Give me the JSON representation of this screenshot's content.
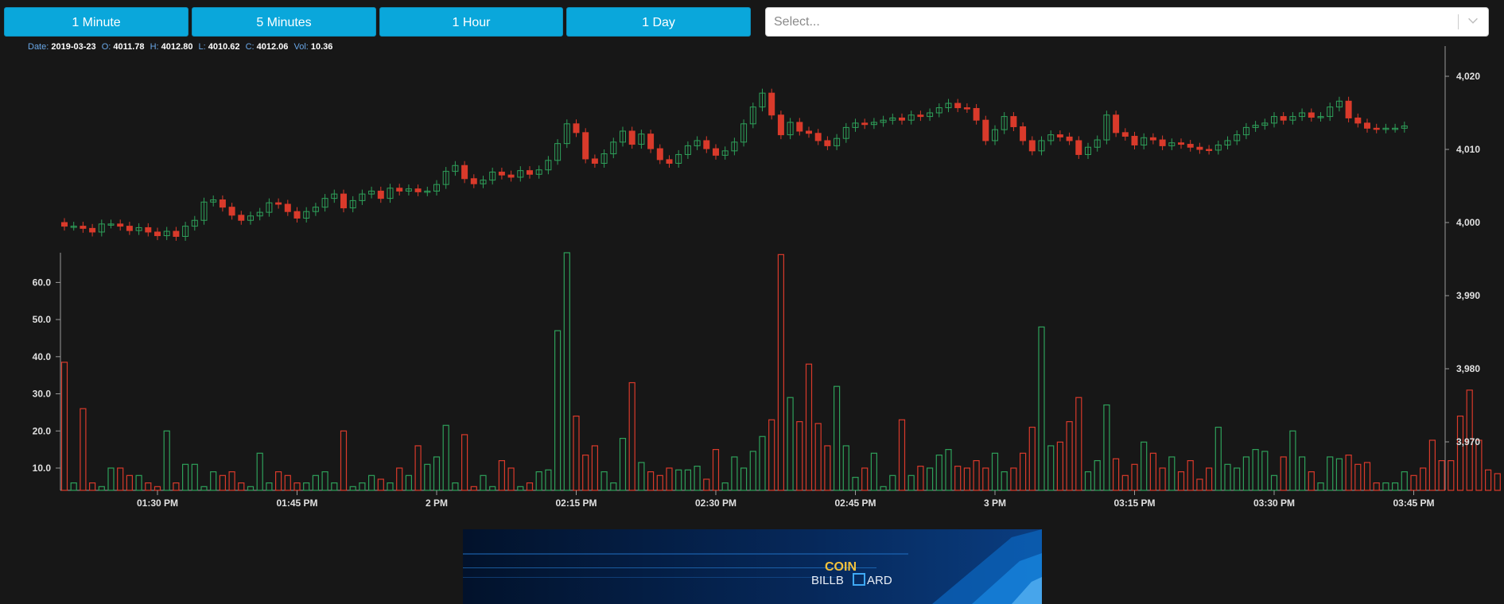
{
  "toolbar": {
    "buttons": [
      "1 Minute",
      "5 Minutes",
      "1 Hour",
      "1 Day"
    ],
    "select_placeholder": "Select..."
  },
  "ohlc": {
    "date_label": "Date:",
    "date": "2019-03-23",
    "open_label": "O:",
    "open": "4011.78",
    "high_label": "H:",
    "high": "4012.80",
    "low_label": "L:",
    "low": "4010.62",
    "close_label": "C:",
    "close": "4012.06",
    "vol_label": "Vol:",
    "vol": "10.36"
  },
  "banner": {
    "word1": "COIN",
    "word2": "BILLB",
    "word3": "ARD"
  },
  "colors": {
    "up": "#2ea05a",
    "down": "#d93a2b",
    "button": "#0aa7db",
    "background": "#171717"
  },
  "chart_data": [
    {
      "type": "candlestick",
      "start_time": "13:20",
      "interval_minutes": 1,
      "price_axis": {
        "ticks": [
          3970,
          3980,
          3990,
          4000,
          4010,
          4020
        ],
        "range": [
          3963,
          4025
        ]
      },
      "time_ticks": [
        "01:30 PM",
        "01:45 PM",
        "2 PM",
        "02:15 PM",
        "02:30 PM",
        "02:45 PM",
        "3 PM",
        "03:15 PM",
        "03:30 PM",
        "03:45 PM"
      ],
      "time_tick_minutes": [
        10,
        25,
        40,
        55,
        70,
        85,
        100,
        115,
        130,
        145
      ],
      "close": [
        3999.5,
        3999.5,
        3999.2,
        3998.7,
        3999.8,
        3999.8,
        3999.5,
        3998.9,
        3999.3,
        3998.7,
        3998.2,
        3998.8,
        3998.1,
        3999.5,
        4000.3,
        4002.8,
        4003.1,
        4002.1,
        4001.0,
        4000.3,
        4000.9,
        4001.4,
        4002.7,
        4002.5,
        4001.5,
        4000.6,
        4001.5,
        4002.1,
        4003.3,
        4003.9,
        4002.0,
        4003.0,
        4003.9,
        4004.3,
        4003.3,
        4004.7,
        4004.3,
        4004.6,
        4004.2,
        4004.3,
        4005.2,
        4007.0,
        4007.8,
        4006.0,
        4005.3,
        4005.8,
        4006.9,
        4006.5,
        4006.2,
        4007.1,
        4006.6,
        4007.2,
        4008.5,
        4010.8,
        4013.5,
        4012.3,
        4008.7,
        4008.1,
        4009.4,
        4011.0,
        4012.5,
        4010.7,
        4012.1,
        4010.1,
        4008.6,
        4008.1,
        4009.3,
        4010.5,
        4011.2,
        4010.1,
        4009.2,
        4009.8,
        4011.0,
        4013.5,
        4015.8,
        4017.7,
        4014.7,
        4012.0,
        4013.7,
        4012.5,
        4012.2,
        4011.2,
        4010.5,
        4011.5,
        4013.0,
        4013.6,
        4013.4,
        4013.7,
        4014.0,
        4014.3,
        4014.0,
        4014.7,
        4014.5,
        4015.0,
        4015.7,
        4016.3,
        4015.7,
        4015.6,
        4014.0,
        4011.2,
        4012.7,
        4014.5,
        4013.1,
        4011.2,
        4009.8,
        4011.2,
        4012.0,
        4011.7,
        4011.2,
        4009.3,
        4010.3,
        4011.3,
        4014.7,
        4012.3,
        4011.8,
        4010.6,
        4011.6,
        4011.3,
        4010.5,
        4010.9,
        4010.7,
        4010.3,
        4010.0,
        4009.9,
        4010.6,
        4011.2,
        4012.0,
        4013.0,
        4013.3,
        4013.6,
        4014.5,
        4014.0,
        4014.5,
        4015.0,
        4014.4,
        4014.5,
        4015.8,
        4016.6,
        4014.3,
        4013.6,
        4012.9,
        4012.8,
        4012.9,
        4012.9,
        4013.2
      ],
      "open": [
        4000.0,
        3999.5,
        3999.5,
        3999.2,
        3998.7,
        3999.8,
        3999.8,
        3999.5,
        3998.9,
        3999.3,
        3998.7,
        3998.2,
        3998.8,
        3998.1,
        3999.5,
        4000.3,
        4002.8,
        4003.1,
        4002.1,
        4001.0,
        4000.3,
        4000.9,
        4001.4,
        4002.7,
        4002.5,
        4001.5,
        4000.6,
        4001.5,
        4002.1,
        4003.3,
        4003.9,
        4002.0,
        4003.0,
        4003.9,
        4004.3,
        4003.3,
        4004.7,
        4004.3,
        4004.6,
        4004.2,
        4004.3,
        4005.2,
        4007.0,
        4007.8,
        4006.0,
        4005.3,
        4005.8,
        4006.9,
        4006.5,
        4006.2,
        4007.1,
        4006.6,
        4007.2,
        4008.5,
        4010.8,
        4013.5,
        4012.3,
        4008.7,
        4008.1,
        4009.4,
        4011.0,
        4012.5,
        4010.7,
        4012.1,
        4010.1,
        4008.6,
        4008.1,
        4009.3,
        4010.5,
        4011.2,
        4010.1,
        4009.2,
        4009.8,
        4011.0,
        4013.5,
        4015.8,
        4017.7,
        4014.7,
        4012.0,
        4013.7,
        4012.5,
        4012.2,
        4011.2,
        4010.5,
        4011.5,
        4013.0,
        4013.6,
        4013.4,
        4013.7,
        4014.0,
        4014.3,
        4014.0,
        4014.7,
        4014.5,
        4015.0,
        4015.7,
        4016.3,
        4015.7,
        4015.6,
        4014.0,
        4011.2,
        4012.7,
        4014.5,
        4013.1,
        4011.2,
        4009.8,
        4011.2,
        4012.0,
        4011.7,
        4011.2,
        4009.3,
        4010.3,
        4011.3,
        4014.7,
        4012.3,
        4011.8,
        4010.6,
        4011.6,
        4011.3,
        4010.5,
        4010.9,
        4010.7,
        4010.3,
        4010.0,
        4009.9,
        4010.6,
        4011.2,
        4012.0,
        4013.0,
        4013.3,
        4013.6,
        4014.5,
        4014.0,
        4014.5,
        4015.0,
        4014.4,
        4014.5,
        4015.8,
        4016.6,
        4014.3,
        4013.6,
        4012.9,
        4012.8,
        4012.9,
        4012.9
      ]
    },
    {
      "type": "bar",
      "ylabel_ticks": [
        "10.0",
        "20.0",
        "30.0",
        "40.0",
        "50.0",
        "60.0"
      ],
      "ylim": [
        4,
        68
      ],
      "volume": [
        38.5,
        6,
        26,
        6,
        5,
        10,
        10,
        8,
        8,
        6,
        5,
        20,
        6,
        11,
        11,
        5,
        9,
        8,
        9,
        6,
        5,
        14,
        6,
        9,
        8,
        6,
        6,
        8,
        9,
        6,
        20,
        5,
        6,
        8,
        7,
        6,
        10,
        8,
        16,
        11,
        13,
        21.5,
        6,
        19,
        5,
        8,
        5,
        12,
        10,
        5,
        6,
        9,
        9.5,
        47,
        68,
        24,
        13.5,
        16,
        9,
        6,
        18,
        33,
        11.5,
        9,
        8,
        10,
        9.5,
        9.5,
        10.5,
        7,
        15,
        6,
        13,
        10,
        14.5,
        18.5,
        23,
        67.5,
        29,
        22.5,
        38,
        22,
        16,
        32,
        16,
        7.5,
        10,
        14,
        5,
        8,
        23,
        8,
        10.5,
        10,
        13.5,
        15,
        10.5,
        10,
        12,
        10,
        14,
        9,
        10,
        14,
        21,
        48,
        16,
        17,
        22.5,
        29,
        9,
        12,
        27,
        12.5,
        8,
        11,
        17,
        14,
        10,
        13,
        9,
        12,
        7,
        10,
        21,
        11,
        10,
        13,
        15,
        14.5,
        8,
        13,
        20,
        13,
        9,
        6,
        13,
        12.5,
        13.5,
        11,
        11.5,
        6,
        6,
        6,
        9,
        8,
        10,
        17.5,
        12,
        12,
        24,
        31,
        17.5,
        9.5,
        8.5
      ]
    }
  ]
}
